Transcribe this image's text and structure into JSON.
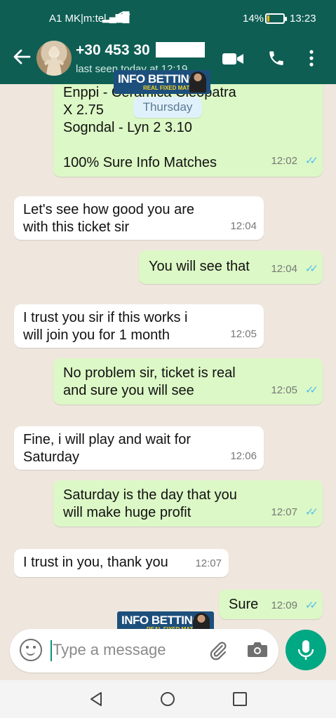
{
  "status_bar": {
    "carrier": "A1 MK|m:tel",
    "signal_icon": "signal-bars-icon",
    "wifi_icon": "wifi-icon",
    "battery_percent": "14%",
    "battery_level": 0.14,
    "time": "13:23"
  },
  "header": {
    "back_icon": "back-arrow-icon",
    "avatar": "contact-avatar-statue",
    "title": "+30 453 30",
    "subtitle": "last seen today at 12:19",
    "video_icon": "video-call-icon",
    "phone_icon": "voice-call-icon",
    "menu_icon": "more-vertical-icon"
  },
  "watermark": {
    "text": "INFO BETTING",
    "subtext": "REAL FIXED MATCHES"
  },
  "date_separator": "Thursday",
  "messages": [
    {
      "direction": "out",
      "text": "Enppi - Ceramica Cleopatra\nX  2.75\nSogndal - Lyn  2  3.10\n\n100% Sure Info Matches",
      "time": "12:02",
      "read": true
    },
    {
      "direction": "in",
      "text": "Let's see how good you are\nwith this ticket sir",
      "time": "12:04"
    },
    {
      "direction": "out",
      "text": "You will see that",
      "time": "12:04",
      "read": true
    },
    {
      "direction": "in",
      "text": "I trust you sir if this works i\nwill join you for 1 month",
      "time": "12:05"
    },
    {
      "direction": "out",
      "text": "No problem sir, ticket is real\nand sure you will see",
      "time": "12:05",
      "read": true
    },
    {
      "direction": "in",
      "text": "Fine, i will play and wait for\nSaturday",
      "time": "12:06"
    },
    {
      "direction": "out",
      "text": "Saturday is the day that you\nwill make huge profit",
      "time": "12:07",
      "read": true
    },
    {
      "direction": "in",
      "text": "I trust in you, thank you",
      "time": "12:07"
    },
    {
      "direction": "out",
      "text": "Sure",
      "time": "12:09",
      "read": true
    }
  ],
  "composer": {
    "placeholder": "Type a message",
    "emoji_icon": "emoji-icon",
    "attach_icon": "paperclip-icon",
    "camera_icon": "camera-icon",
    "mic_icon": "microphone-icon"
  },
  "nav_bar": {
    "back": "nav-back-icon",
    "home": "nav-home-icon",
    "recents": "nav-recents-icon"
  },
  "colors": {
    "header": "#0e5e54",
    "outgoing_bubble": "#dcf8c6",
    "incoming_bubble": "#ffffff",
    "chat_background": "#efe7de",
    "read_ticks": "#53bdeb",
    "mic_button": "#00a884"
  }
}
